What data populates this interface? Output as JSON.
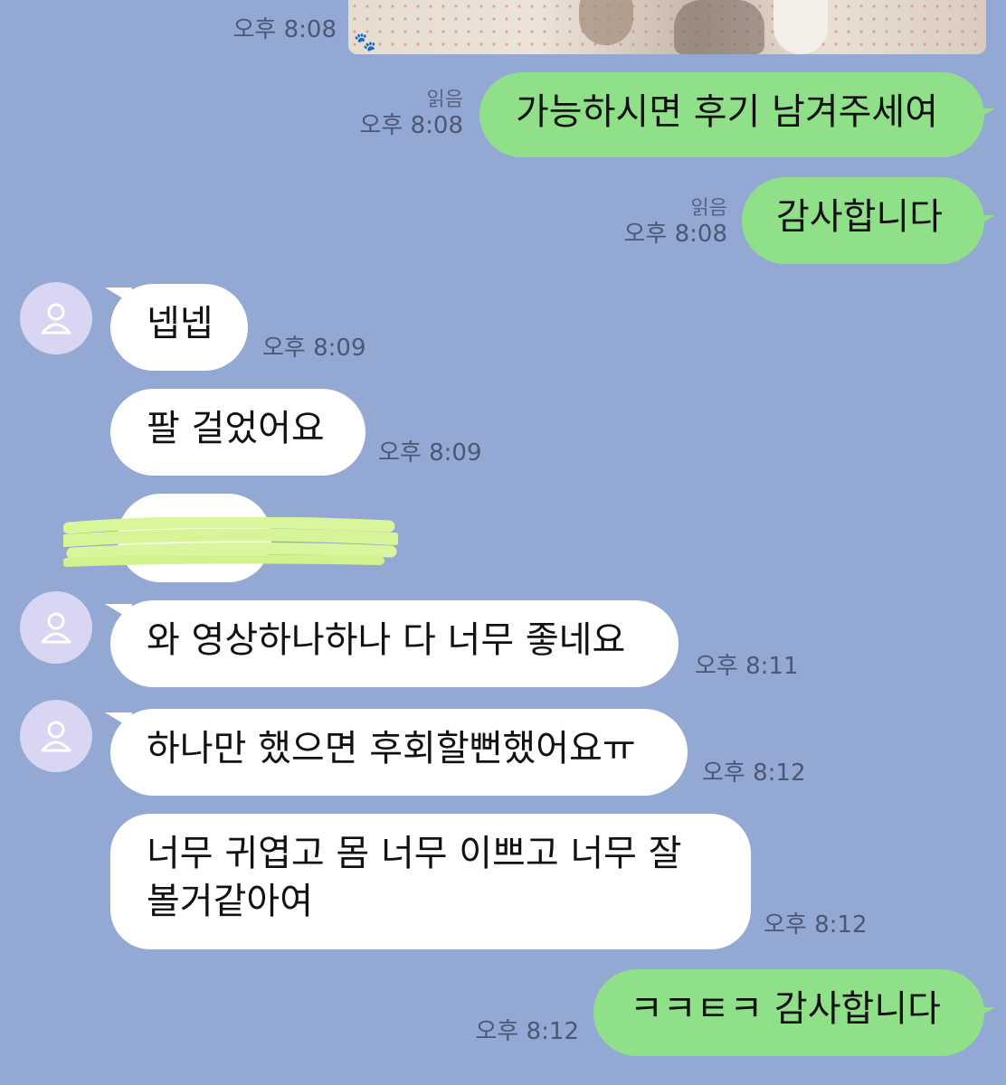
{
  "chat": {
    "top_image_time": "오후 8:08",
    "messages": [
      {
        "id": "m1",
        "text": "가능하시면 후기 남겨주세여",
        "time": "오후 8:08",
        "read": "읽음"
      },
      {
        "id": "m2",
        "text": "감사합니다",
        "time": "오후 8:08",
        "read": "읽음"
      },
      {
        "id": "m3",
        "text": "넵넵",
        "time": "오후 8:09"
      },
      {
        "id": "m4",
        "text": "팔 걸었어요",
        "time": "오후 8:09"
      },
      {
        "id": "m6",
        "text": "와 영상하나하나 다 너무 좋네요",
        "time": "오후 8:11"
      },
      {
        "id": "m7",
        "text": "하나만 했으면 후회할뻔했어요ㅠ",
        "time": "오후 8:12"
      },
      {
        "id": "m8",
        "line1": "너무 귀엽고 몸 너무 이쁘고 너무 잘",
        "line2": "볼거같아여",
        "time": "오후 8:12"
      },
      {
        "id": "m9",
        "text": "ㅋㅋㅌㅋ 감사합니다",
        "time": "오후 8:12"
      }
    ]
  }
}
